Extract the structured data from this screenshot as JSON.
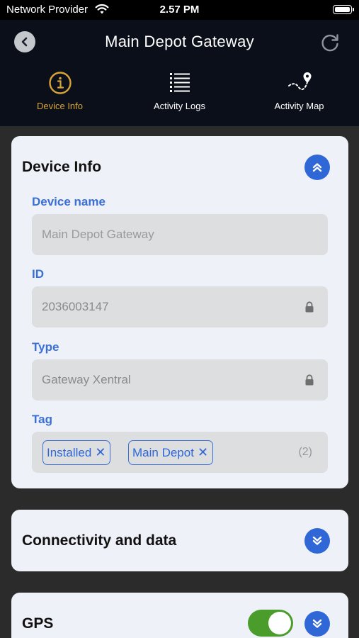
{
  "status_bar": {
    "carrier": "Network Provider",
    "time": "2.57 PM"
  },
  "header": {
    "title": "Main Depot Gateway",
    "tabs": [
      {
        "label": "Device Info",
        "icon": "info-circle-icon",
        "active": true
      },
      {
        "label": "Activity Logs",
        "icon": "list-icon",
        "active": false
      },
      {
        "label": "Activity Map",
        "icon": "route-map-icon",
        "active": false
      }
    ]
  },
  "device_info": {
    "title": "Device Info",
    "fields": {
      "name": {
        "label": "Device name",
        "placeholder": "Main Depot Gateway"
      },
      "id": {
        "label": "ID",
        "value": "2036003147"
      },
      "type": {
        "label": "Type",
        "value": "Gateway Xentral"
      },
      "tag": {
        "label": "Tag",
        "chips": [
          "Installed",
          "Main Depot"
        ],
        "count": "(2)"
      }
    }
  },
  "connectivity": {
    "title": "Connectivity and data"
  },
  "gps": {
    "title": "GPS",
    "enabled": true
  },
  "colors": {
    "accent": "#2f67d6",
    "active_tab": "#d8a437",
    "toggle_on": "#4a9d2a",
    "header_bg": "#0b0f1a"
  }
}
